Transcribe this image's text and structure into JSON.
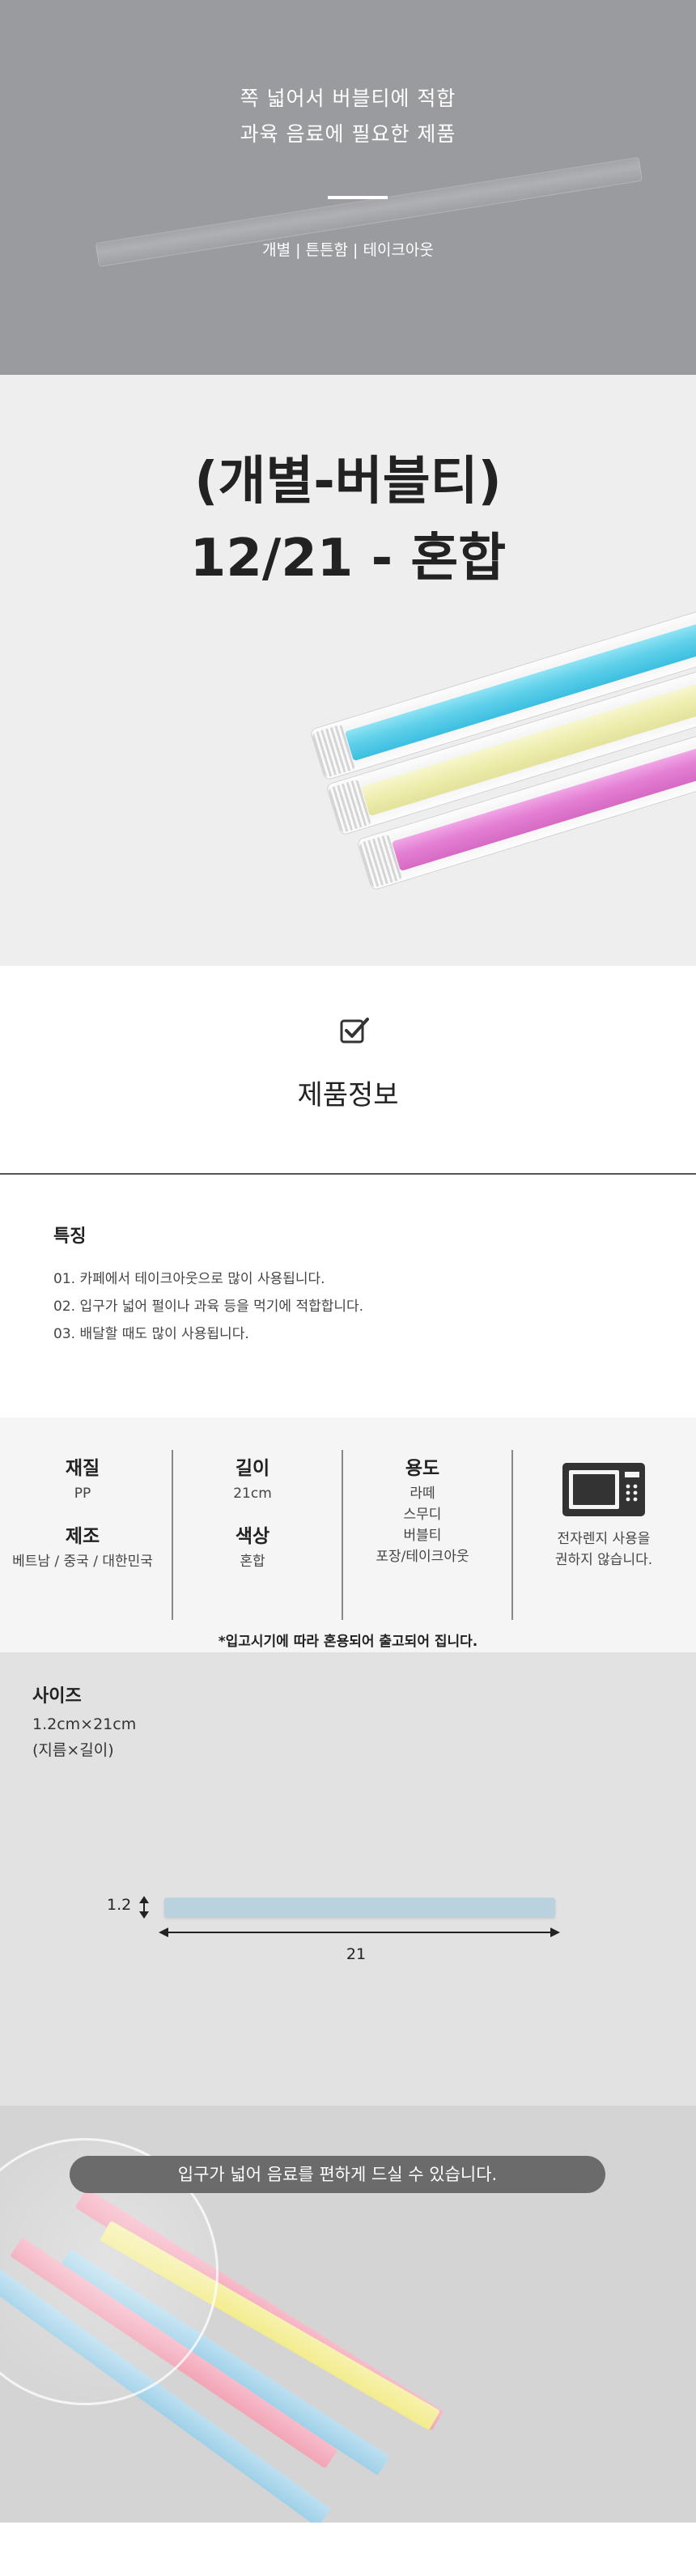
{
  "hero": {
    "line1": "쪽 넓어서 버블티에 적합",
    "line2": "과육 음료에 필요한 제품",
    "tags": "개별 | 튼튼함 | 테이크아웃"
  },
  "title": {
    "line1": "(개별-버블티)",
    "line2": "12/21 - 혼합"
  },
  "info": {
    "title": "제품정보"
  },
  "features": {
    "title": "특징",
    "items": [
      "01. 카페에서 테이크아웃으로 많이 사용됩니다.",
      "02. 입구가 넓어 펄이나 과육 등을 먹기에 적합합니다.",
      "03. 배달할 때도 많이 사용됩니다."
    ]
  },
  "spec": {
    "material_label": "재질",
    "material_value": "PP",
    "maker_label": "제조",
    "maker_value": "베트남 / 중국 / 대한민국",
    "length_label": "길이",
    "length_value": "21cm",
    "color_label": "색상",
    "color_value": "혼합",
    "usage_label": "용도",
    "usage_values": [
      "라떼",
      "스무디",
      "버블티",
      "포장/테이크아웃"
    ],
    "microwave_line1": "전자렌지 사용을",
    "microwave_line2": "권하지 않습니다.",
    "note": "*입고시기에 따라 혼용되어 출고되어 집니다."
  },
  "size": {
    "title": "사이즈",
    "dimension": "1.2cm×21cm",
    "dimension_note": "(지름×길이)",
    "diameter_label": "1.2",
    "length_label": "21"
  },
  "photo": {
    "caption": "입구가 넓어 음료를 편하게 드실 수 있습니다."
  },
  "colors": {
    "hero_bg": "#9a9b9f",
    "title_bg": "#eeeeee",
    "spec_bg": "#f5f5f5",
    "size_bg": "#e2e2e2",
    "straw_blue": "#5fd0ea",
    "straw_yellow": "#eeeeb0",
    "straw_pink": "#e47fd3",
    "photo_pink": "#f2a5b5",
    "photo_yellow": "#f3ec8e",
    "photo_blue": "#9fd0e8"
  }
}
